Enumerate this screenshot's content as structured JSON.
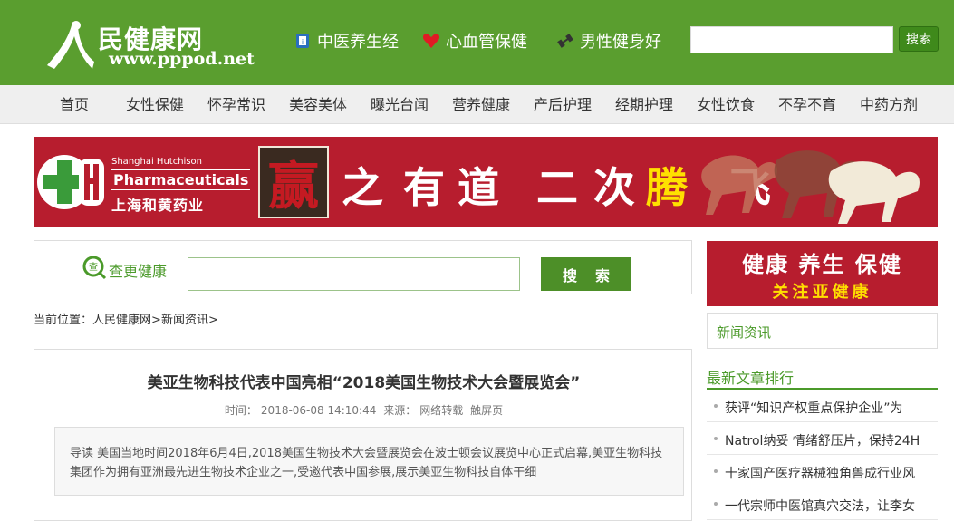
{
  "header": {
    "logo_title": "民健康网",
    "logo_url": "www.pppod.net",
    "links": [
      {
        "label": "中医养生经",
        "icon": "tcm-book-icon"
      },
      {
        "label": "心血管保健",
        "icon": "heart-icon"
      },
      {
        "label": "男性健身好",
        "icon": "dumbbell-icon"
      }
    ],
    "search_placeholder": "",
    "search_button": "搜索"
  },
  "nav": {
    "items": [
      "首页",
      "女性保健",
      "怀孕常识",
      "美容美体",
      "曝光台闻",
      "营养健康",
      "产后护理",
      "经期护理",
      "女性饮食",
      "不孕不育",
      "中药方剂"
    ]
  },
  "banner": {
    "brand_en_small": "Shanghai Hutchison",
    "brand_en": "Pharmaceuticals",
    "brand_cn": "上海和黄药业",
    "box_char": "赢",
    "slogan_1": "之",
    "slogan_2": "有",
    "slogan_3": "道",
    "slogan_4": "二",
    "slogan_5": "次",
    "slogan_6": "腾",
    "slogan_7": "飞"
  },
  "search_strip": {
    "label": "查更健康",
    "placeholder": "",
    "button": "搜索"
  },
  "breadcrumb": {
    "prefix": "当前位置：",
    "home": "人民健康网",
    "sep1": ">",
    "section": "新闻资讯",
    "sep2": ">"
  },
  "article": {
    "title": "美亚生物科技代表中国亮相“2018美国生物技术大会暨展览会”",
    "time_label": "时间：",
    "time": "2018-06-08 14:10:44",
    "source_label": "来源：",
    "source": "网络转载",
    "touch": "触屏页",
    "intro": "导读 美国当地时间2018年6月4日,2018美国生物技术大会暨展览会在波士顿会议展览中心正式启幕,美亚生物科技集团作为拥有亚洲最先进生物技术企业之一,受邀代表中国参展,展示美亚生物科技自体干细"
  },
  "sidebar": {
    "banner_line1": "健康 养生 保健",
    "banner_line2": "关注亚健康",
    "news_box": "新闻资讯",
    "ranking_title": "最新文章排行",
    "ranking": [
      "获评“知识产权重点保护企业”为",
      "Natrol纳妥 情绪舒压片，保持24H",
      "十家国产医疗器械独角兽成行业风",
      "一代宗师中医馆真穴交法，让李女"
    ]
  },
  "colors": {
    "header_green": "#5a9e2f",
    "accent_green": "#4b9a2a",
    "banner_red": "#b71d2e",
    "gold": "#ffe000"
  }
}
